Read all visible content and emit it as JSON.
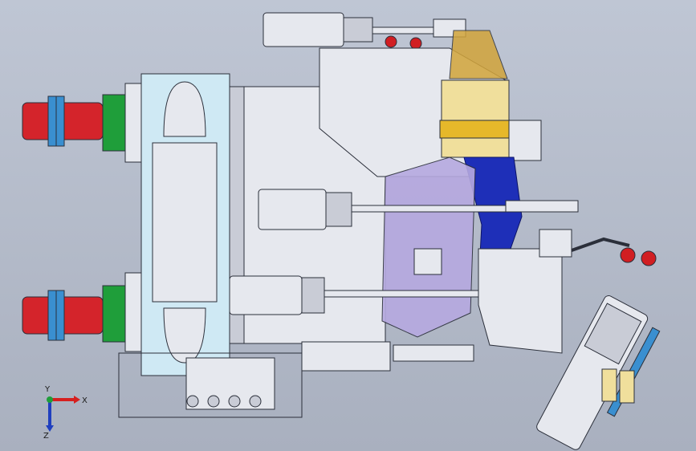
{
  "viewport": {
    "background_top": "#bfc6d4",
    "background_bottom": "#a9b0bf"
  },
  "colors": {
    "steel": "#e6e8ee",
    "steel_dark": "#c9ccd6",
    "outline": "#2b2f3a",
    "clamp_red": "#d4242b",
    "plate_green": "#1f9e3a",
    "cylinder_blue": "#3a8fd0",
    "part_blue": "#1e2fb8",
    "bracket_gold": "#d2a43a",
    "frame_ring": "#cfe9f4",
    "purple_part": "#b6a9e0",
    "handle_red": "#d11e22"
  },
  "triad": {
    "x_label": "X",
    "y_label": "Y",
    "z_label": "Z",
    "x_color": "#d61f1f",
    "y_color": "#1f9e3a",
    "z_color": "#1f3fbf"
  }
}
